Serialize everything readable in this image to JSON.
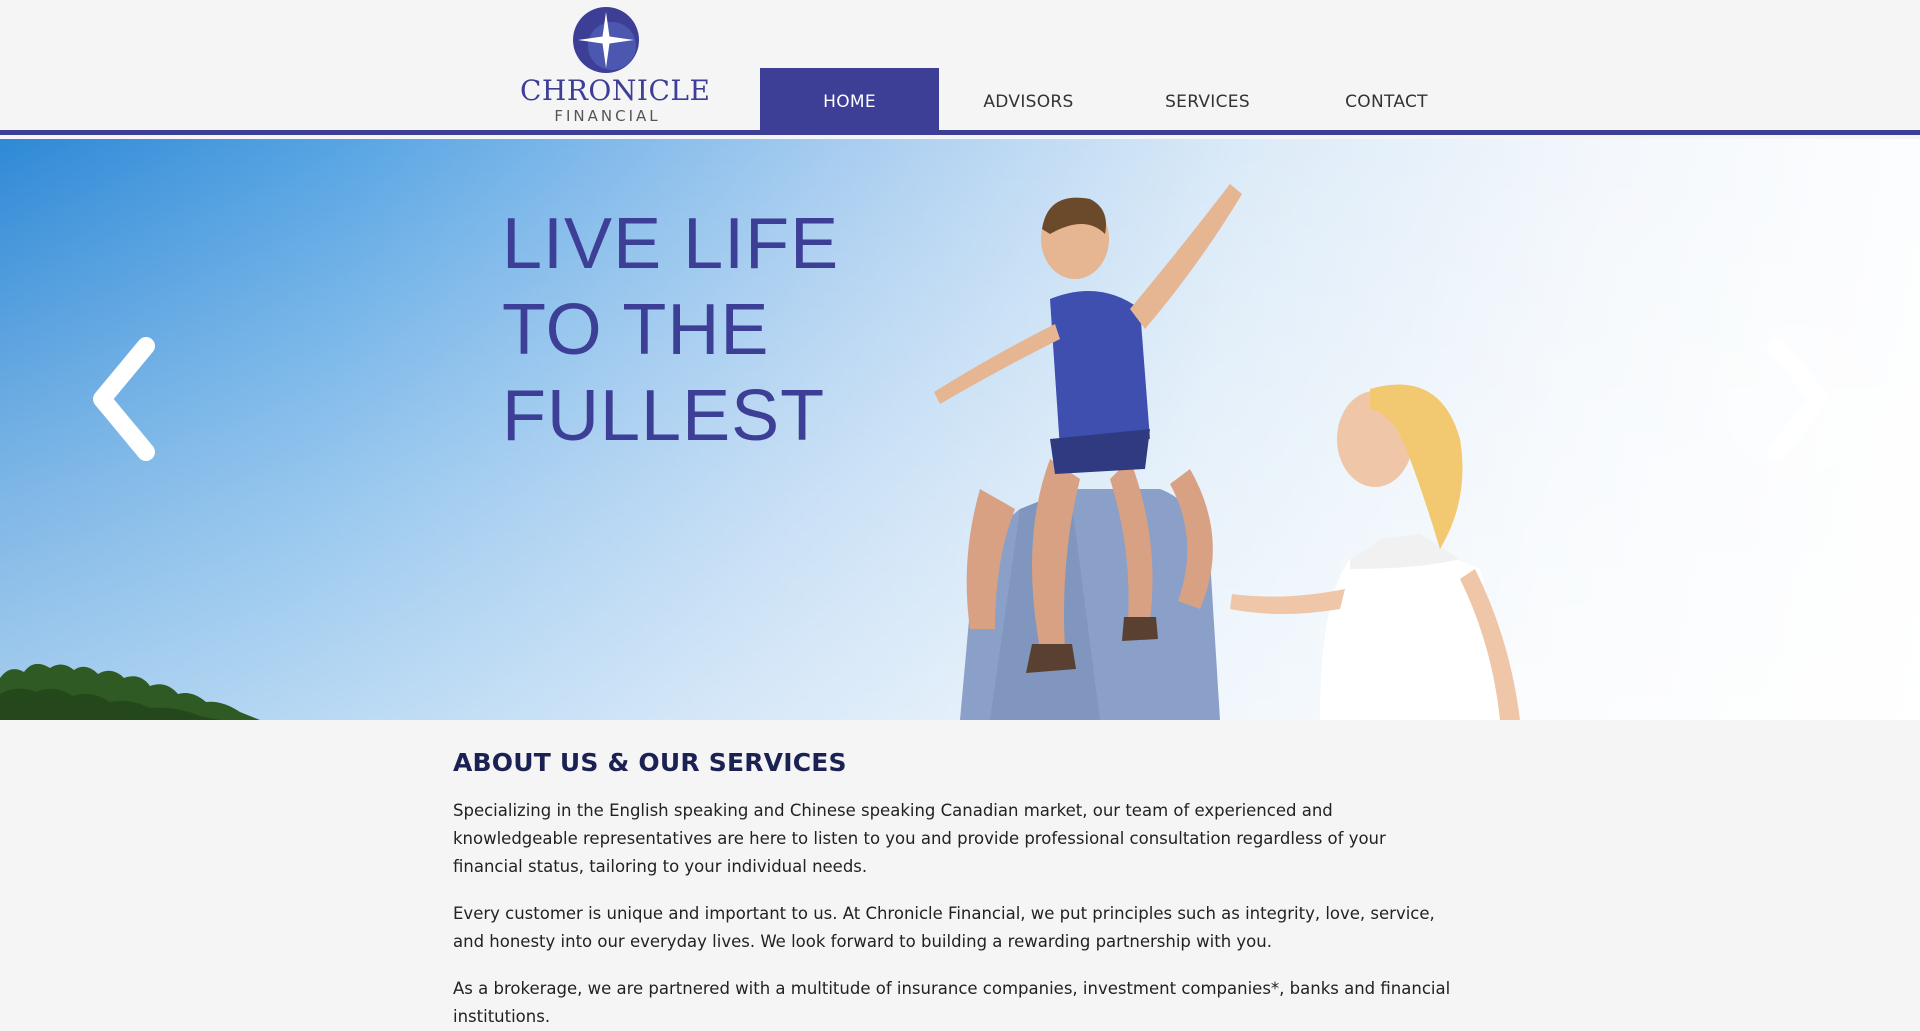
{
  "brand": {
    "name": "CHRONICLE",
    "sub": "FINANCIAL",
    "accent": "#3d3f97"
  },
  "nav": {
    "items": [
      {
        "label": "HOME",
        "active": true
      },
      {
        "label": "ADVISORS",
        "active": false
      },
      {
        "label": "SERVICES",
        "active": false
      },
      {
        "label": "CONTACT",
        "active": false
      }
    ]
  },
  "hero": {
    "lines": [
      "LIVE LIFE",
      "TO THE",
      "FULLEST"
    ],
    "prev_icon": "chevron-left-icon",
    "next_icon": "chevron-right-icon"
  },
  "about": {
    "title": "ABOUT US & OUR SERVICES",
    "paragraphs": [
      "Specializing in the English speaking and Chinese speaking Canadian market, our team of experienced and knowledgeable representatives are here to listen to you and provide professional consultation regardless of your financial status, tailoring to your individual needs.",
      "Every customer is unique and important to us. At Chronicle Financial, we put principles such as integrity, love, service, and honesty into our everyday lives. We look forward to building a rewarding partnership with you.",
      "As a brokerage, we are partnered with a multitude of insurance companies, investment companies*, banks and financial institutions."
    ]
  }
}
